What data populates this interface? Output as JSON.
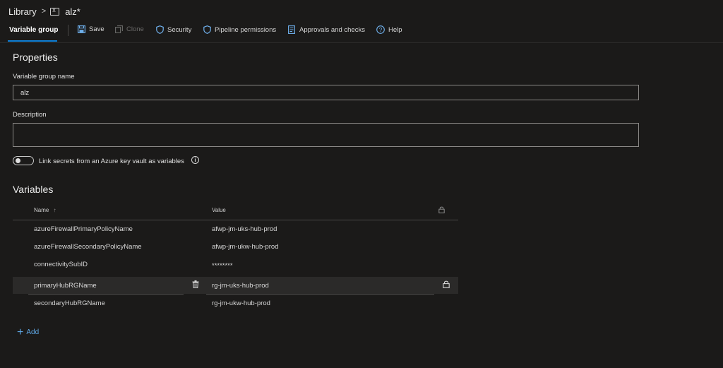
{
  "breadcrumb": {
    "root": "Library",
    "separator": ">",
    "current": "alz*"
  },
  "toolbar": {
    "active_tab": "Variable group",
    "save": "Save",
    "clone": "Clone",
    "security": "Security",
    "pipeline_permissions": "Pipeline permissions",
    "approvals": "Approvals and checks",
    "help": "Help"
  },
  "properties": {
    "heading": "Properties",
    "name_label": "Variable group name",
    "name_value": "alz",
    "description_label": "Description",
    "description_value": "",
    "link_secrets_label": "Link secrets from an Azure key vault as variables",
    "link_secrets_enabled": false
  },
  "variables": {
    "heading": "Variables",
    "columns": {
      "name": "Name",
      "sort_indicator": "↑",
      "value": "Value"
    },
    "rows": [
      {
        "name": "azureFirewallPrimaryPolicyName",
        "value": "afwp-jm-uks-hub-prod"
      },
      {
        "name": "azureFirewallSecondaryPolicyName",
        "value": "afwp-jm-ukw-hub-prod"
      },
      {
        "name": "connectivitySubID",
        "value": "********"
      },
      {
        "name": "primaryHubRGName",
        "value": "rg-jm-uks-hub-prod"
      },
      {
        "name": "secondaryHubRGName",
        "value": "rg-jm-ukw-hub-prod"
      }
    ],
    "add_label": "Add"
  },
  "colors": {
    "accent": "#0e7fd6",
    "link": "#5fa8e6",
    "background": "#1b1a19"
  }
}
